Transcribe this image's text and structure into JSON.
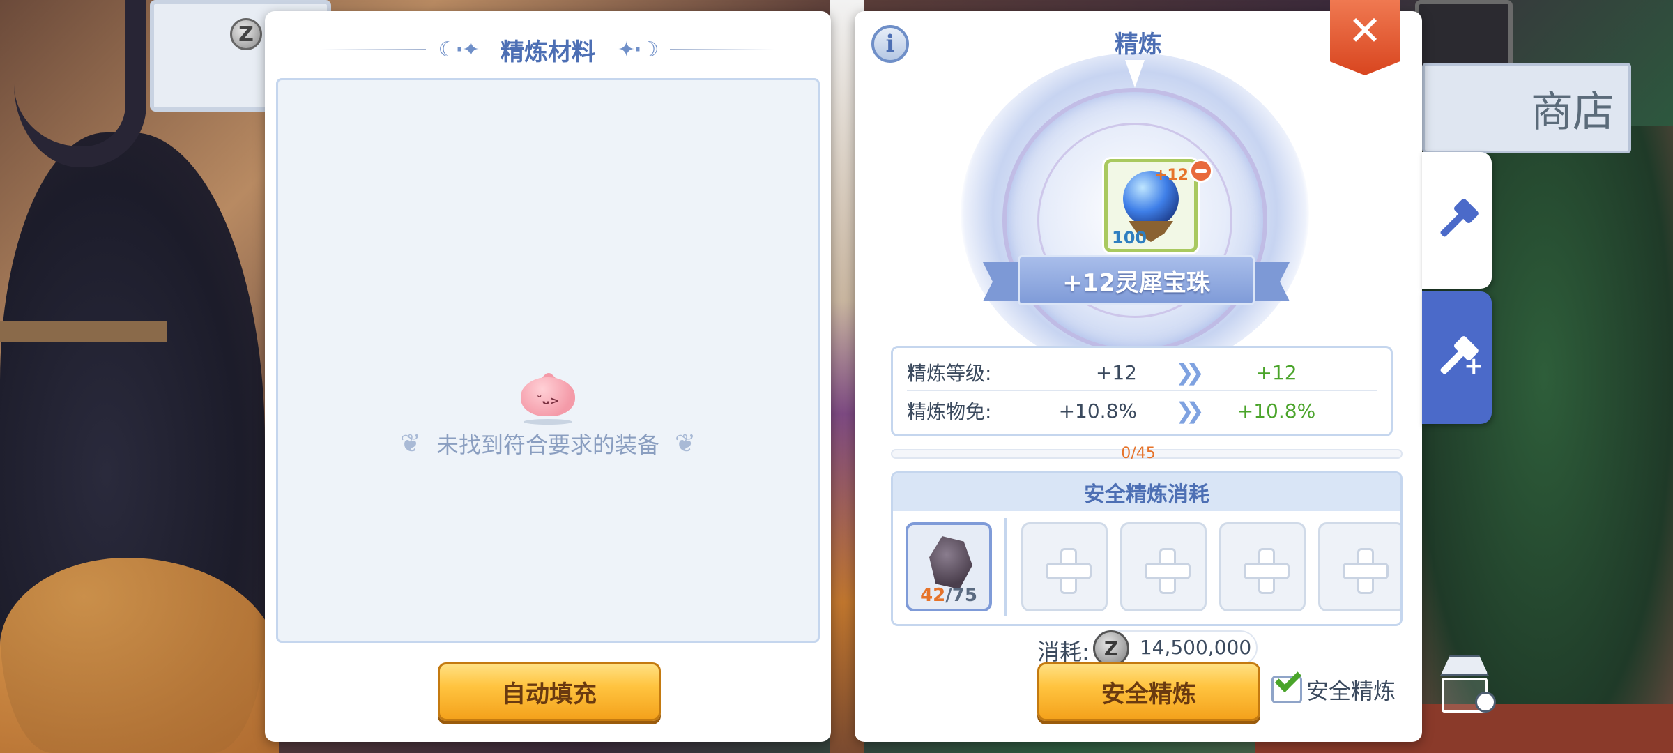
{
  "background": {
    "sign_coin_letter": "Z",
    "shop_sign_text": "商店"
  },
  "materials_panel": {
    "title": "精炼材料",
    "empty_message": "未找到符合要求的装备",
    "auto_fill_label": "自动填充"
  },
  "refine_panel": {
    "info_label": "i",
    "title": "精炼",
    "close_label": "✕",
    "item": {
      "name": "+12灵犀宝珠",
      "level_badge": "+12",
      "durability": "100",
      "icon": "crystal-orb-icon"
    },
    "stats": [
      {
        "label": "精炼等级:",
        "from": "+12",
        "to": "+12"
      },
      {
        "label": "精炼物免:",
        "from": "+10.8%",
        "to": "+10.8%"
      }
    ],
    "arrow_glyph": "❯❯",
    "progress": {
      "text": "0/45",
      "current": 0,
      "max": 45
    },
    "cost_section": {
      "title": "安全精炼消耗",
      "material": {
        "have": "42",
        "separator": "/",
        "need": "75",
        "icon": "ore-icon"
      },
      "empty_slots": 4
    },
    "fee": {
      "label": "消耗:",
      "currency_letter": "Z",
      "value": "14,500,000"
    },
    "safe_refine_button": "安全精炼",
    "safe_refine_checkbox": {
      "label": "安全精炼",
      "checked": true
    }
  },
  "side_tabs": [
    {
      "name": "refine",
      "icon": "hammer-icon",
      "active": true
    },
    {
      "name": "enchant",
      "icon": "hammer-plus-icon",
      "active": false
    }
  ],
  "colors": {
    "accent_blue": "#4d6fb4",
    "increase_green": "#4aa42a",
    "highlight_orange": "#e6732a",
    "close_red": "#d8451f"
  }
}
